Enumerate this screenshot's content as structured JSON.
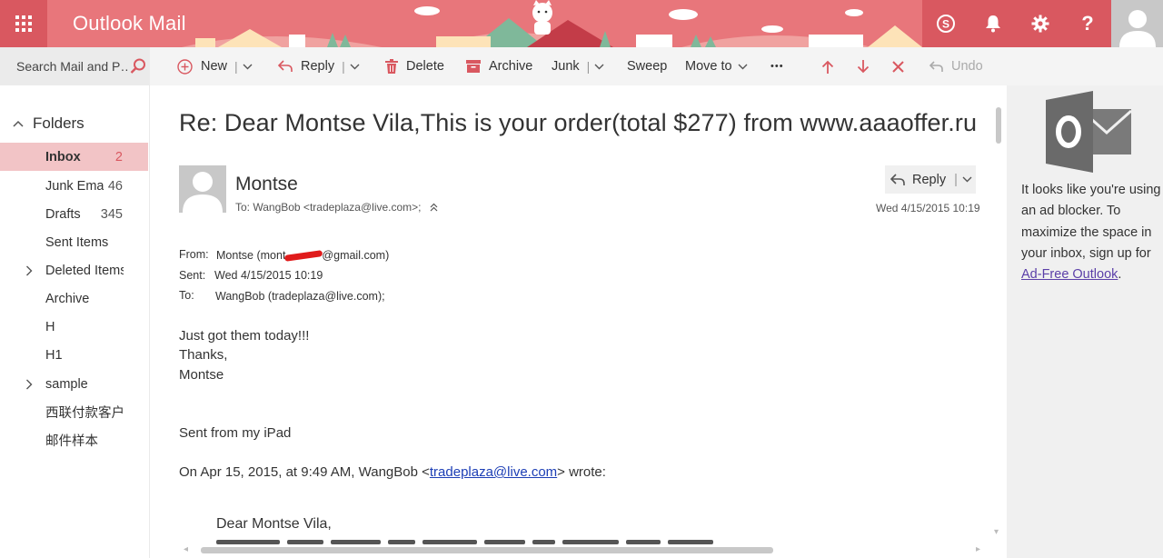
{
  "header": {
    "app_title": "Outlook Mail",
    "icons": [
      "app-launcher-icon",
      "skype-icon",
      "bell-icon",
      "gear-icon",
      "help-icon",
      "user-avatar-icon"
    ],
    "help_label": "?"
  },
  "toolbar": {
    "search_placeholder": "Search Mail and People",
    "search_display": "Search Mail and P…",
    "new_label": "New",
    "reply_label": "Reply",
    "delete_label": "Delete",
    "archive_label": "Archive",
    "junk_label": "Junk",
    "sweep_label": "Sweep",
    "move_to_label": "Move to",
    "more_label": "•••",
    "undo_label": "Undo"
  },
  "sidebar": {
    "folders_label": "Folders",
    "items": [
      {
        "label": "Inbox",
        "count": "2",
        "selected": true
      },
      {
        "label": "Junk Ema",
        "count": "46"
      },
      {
        "label": "Drafts",
        "count": "345"
      },
      {
        "label": "Sent Items",
        "count": ""
      },
      {
        "label": "Deleted Items",
        "count": "",
        "expandable": true
      },
      {
        "label": "Archive",
        "count": ""
      },
      {
        "label": "H",
        "count": ""
      },
      {
        "label": "H1",
        "count": ""
      },
      {
        "label": "sample",
        "count": "",
        "expandable": true
      },
      {
        "label": "西联付款客户",
        "count": ""
      },
      {
        "label": "邮件样本",
        "count": ""
      }
    ]
  },
  "message": {
    "subject": "Re: Dear Montse Vila,This is your order(total $277) from www.aaaoffer.ru",
    "sender": "Montse",
    "to_line": "To: WangBob <tradeplaza@live.com>;",
    "date": "Wed 4/15/2015 10:19",
    "reply_label": "Reply",
    "from_field": "From:",
    "from_prefix": "Montse (mont",
    "from_suffix": "@gmail.com)",
    "sent_field": "Sent:",
    "sent_value": "Wed 4/15/2015 10:19",
    "to_field": "To:",
    "to_value": "WangBob (tradeplaza@live.com);",
    "body_line1": "Just got them today!!!",
    "body_line2": "Thanks,",
    "body_line3": "Montse",
    "body_line4": "Sent from my iPad",
    "quote_prefix": "On Apr 15, 2015, at 9:49 AM, WangBob <",
    "quote_email": "tradeplaza@live.com",
    "quote_suffix": "> wrote:",
    "quoted_greeting": "Dear Montse Vila,"
  },
  "ad_pane": {
    "text": "It looks like you're using an ad blocker. To maximize the space in your inbox, sign up for",
    "link": "Ad-Free Outlook",
    "period": "."
  },
  "colors": {
    "header_bg": "#e8767b",
    "header_button_bg": "#d95860",
    "selected_folder_bg": "#f2c4c6",
    "link": "#1c3eb5"
  }
}
